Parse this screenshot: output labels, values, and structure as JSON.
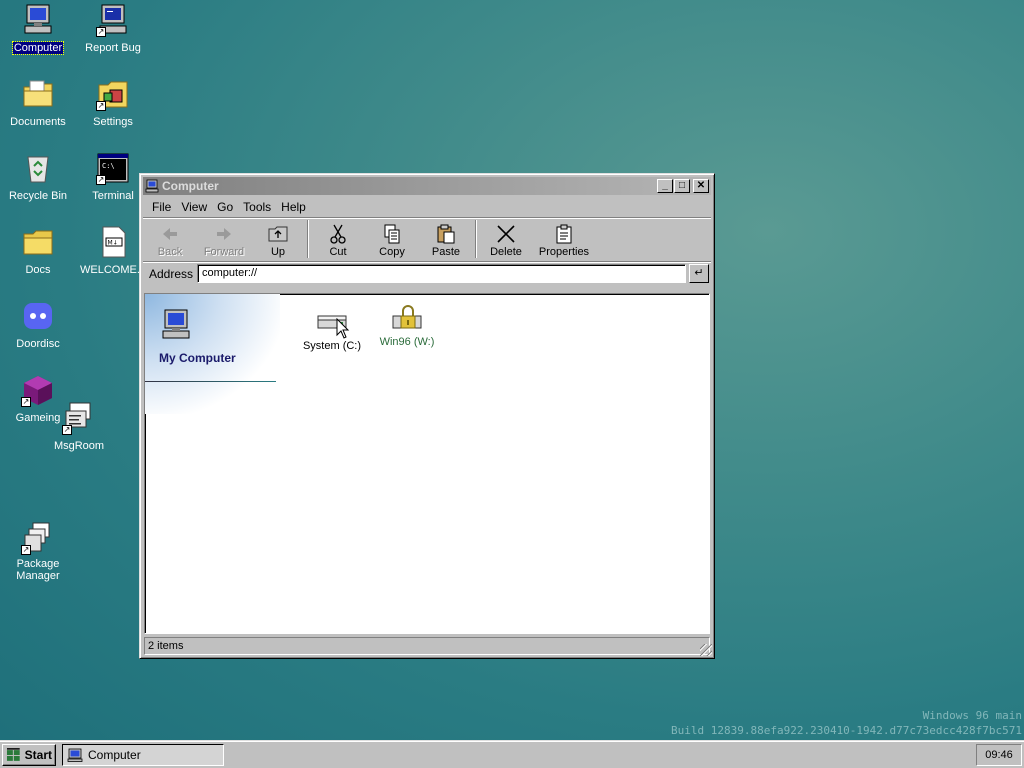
{
  "desktop": {
    "icons": [
      {
        "label": "Computer",
        "icon": "computer-icon",
        "selected": true
      },
      {
        "label": "Report Bug",
        "icon": "report-bug-icon"
      },
      {
        "label": "Documents",
        "icon": "documents-folder-icon"
      },
      {
        "label": "Settings",
        "icon": "settings-icon"
      },
      {
        "label": "Recycle Bin",
        "icon": "recycle-bin-icon"
      },
      {
        "label": "Terminal",
        "icon": "terminal-icon"
      },
      {
        "label": "Docs",
        "icon": "folder-icon"
      },
      {
        "label": "WELCOME...",
        "icon": "markdown-file-icon"
      },
      {
        "label": "Doordisc",
        "icon": "doordisc-icon"
      },
      {
        "label": "Gameing",
        "icon": "game-cube-icon"
      },
      {
        "label": "MsgRoom",
        "icon": "msgroom-icon"
      },
      {
        "label": "Package Manager",
        "icon": "package-manager-icon"
      }
    ],
    "watermark_line1": "Windows 96 main",
    "watermark_line2": "Build 12839.88efa922.230410-1942.d77c73edcc428f7bc571"
  },
  "window": {
    "title": "Computer",
    "minimize": "_",
    "maximize": "□",
    "close": "✕",
    "menu": [
      "File",
      "View",
      "Go",
      "Tools",
      "Help"
    ],
    "toolbar": {
      "back": "Back",
      "forward": "Forward",
      "up": "Up",
      "cut": "Cut",
      "copy": "Copy",
      "paste": "Paste",
      "delete": "Delete",
      "properties": "Properties"
    },
    "address_label": "Address",
    "address_value": "computer://",
    "go_glyph": "↵",
    "side_title": "My Computer",
    "drives": [
      {
        "label": "System (C:)",
        "icon": "hard-drive-icon"
      },
      {
        "label": "Win96 (W:)",
        "icon": "locked-drive-icon"
      }
    ],
    "status": "2 items"
  },
  "taskbar": {
    "start_label": "Start",
    "task_label": "Computer",
    "clock": "09:46"
  }
}
